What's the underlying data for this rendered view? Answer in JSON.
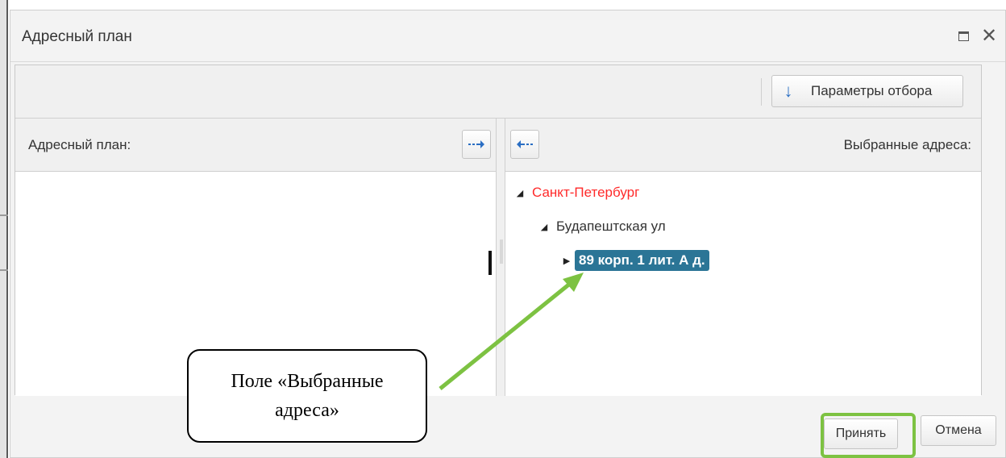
{
  "window": {
    "title": "Адресный план",
    "maximize_icon": "maximize-icon",
    "close_icon": "close-icon",
    "close_glyph": "✕"
  },
  "toolbar": {
    "filter_label": "Параметры отбора",
    "filter_icon": "arrow-down-icon",
    "filter_glyph": "↓"
  },
  "left_panel": {
    "title": "Адресный план:",
    "move_icon": "arrow-right-icon"
  },
  "right_panel": {
    "title": "Выбранные адреса:",
    "move_icon": "arrow-left-icon",
    "tree": {
      "city": {
        "label": "Санкт-Петербург",
        "expanded": true,
        "color": "#ff2a2a"
      },
      "street": {
        "label": "Будапештская ул",
        "expanded": true
      },
      "house": {
        "label": "89 корп. 1 лит. А д.",
        "expanded": false,
        "selected": true,
        "color": "#2b7596"
      }
    }
  },
  "footer": {
    "accept_label": "Принять",
    "cancel_label": "Отмена"
  },
  "annotation": {
    "callout_line1": "Поле «Выбранные",
    "callout_line2": "адреса»",
    "arrow_color": "#7dc242",
    "highlight_color": "#7dc242"
  }
}
